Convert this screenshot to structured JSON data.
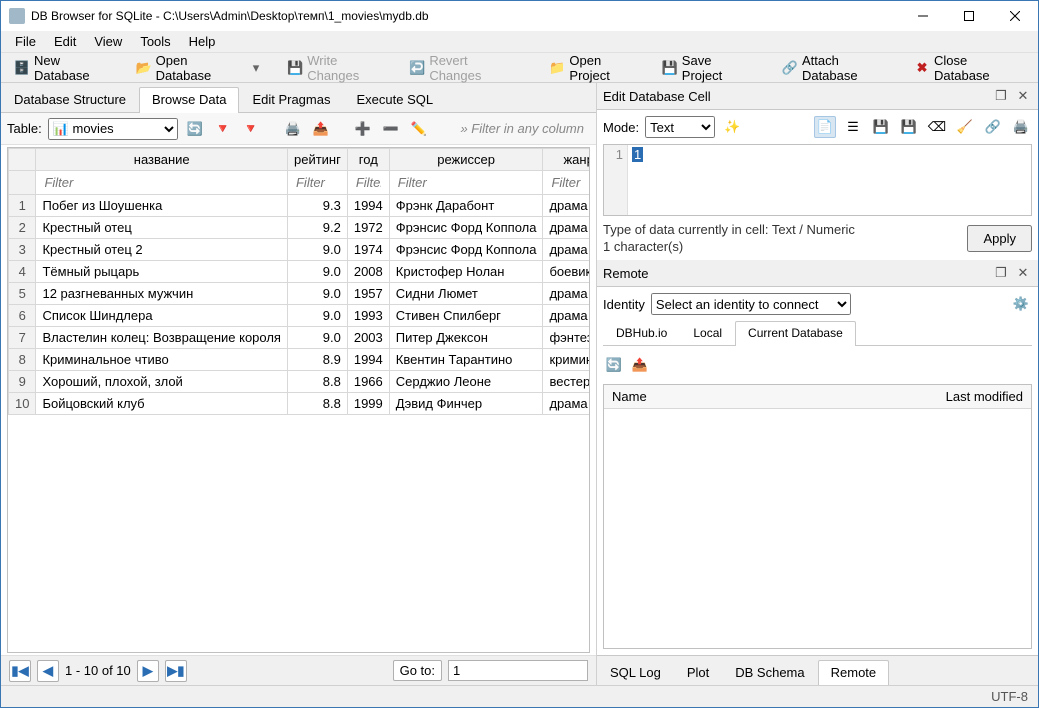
{
  "window_title": "DB Browser for SQLite - C:\\Users\\Admin\\Desktop\\темп\\1_movies\\mydb.db",
  "menus": [
    "File",
    "Edit",
    "View",
    "Tools",
    "Help"
  ],
  "toolbar": {
    "new_db": "New Database",
    "open_db": "Open Database",
    "write_changes": "Write Changes",
    "revert_changes": "Revert Changes",
    "open_project": "Open Project",
    "save_project": "Save Project",
    "attach_db": "Attach Database",
    "close_db": "Close Database"
  },
  "main_tabs": [
    "Database Structure",
    "Browse Data",
    "Edit Pragmas",
    "Execute SQL"
  ],
  "main_tab_active": 1,
  "browse": {
    "table_label": "Table:",
    "table_select_icon": "table-icon",
    "table_name": "movies",
    "filter_any": "Filter in any column"
  },
  "grid": {
    "columns": [
      "название",
      "рейтинг",
      "год",
      "режиссер",
      "жанр"
    ],
    "filter_placeholder": "Filter",
    "rows": [
      {
        "n": 1,
        "name": "Побег из Шоушенка",
        "rating": "9.3",
        "year": "1994",
        "dir": "Фрэнк Дарабонт",
        "genre": "драма"
      },
      {
        "n": 2,
        "name": "Крестный отец",
        "rating": "9.2",
        "year": "1972",
        "dir": "Фрэнсис Форд Коппола",
        "genre": "драма"
      },
      {
        "n": 3,
        "name": "Крестный отец 2",
        "rating": "9.0",
        "year": "1974",
        "dir": "Фрэнсис Форд Коппола",
        "genre": "драма"
      },
      {
        "n": 4,
        "name": "Тёмный рыцарь",
        "rating": "9.0",
        "year": "2008",
        "dir": "Кристофер Нолан",
        "genre": "боевик"
      },
      {
        "n": 5,
        "name": "12 разгневанных мужчин",
        "rating": "9.0",
        "year": "1957",
        "dir": "Сидни Люмет",
        "genre": "драма"
      },
      {
        "n": 6,
        "name": "Список Шиндлера",
        "rating": "9.0",
        "year": "1993",
        "dir": "Стивен Спилберг",
        "genre": "драма"
      },
      {
        "n": 7,
        "name": "Властелин колец: Возвращение короля",
        "rating": "9.0",
        "year": "2003",
        "dir": "Питер Джексон",
        "genre": "фэнтези"
      },
      {
        "n": 8,
        "name": "Криминальное чтиво",
        "rating": "8.9",
        "year": "1994",
        "dir": "Квентин Тарантино",
        "genre": "криминал"
      },
      {
        "n": 9,
        "name": "Хороший, плохой, злой",
        "rating": "8.8",
        "year": "1966",
        "dir": "Серджио Леоне",
        "genre": "вестерн"
      },
      {
        "n": 10,
        "name": "Бойцовский клуб",
        "rating": "8.8",
        "year": "1999",
        "dir": "Дэвид Финчер",
        "genre": "драма"
      }
    ]
  },
  "pager": {
    "range": "1 - 10 of 10",
    "goto_label": "Go to:",
    "goto_value": "1"
  },
  "editcell": {
    "title": "Edit Database Cell",
    "mode_label": "Mode:",
    "mode_value": "Text",
    "line_no": "1",
    "content": "1",
    "type_line": "Type of data currently in cell: Text / Numeric",
    "char_line": "1 character(s)",
    "apply": "Apply"
  },
  "remote": {
    "title": "Remote",
    "identity_label": "Identity",
    "identity_value": "Select an identity to connect",
    "tabs": [
      "DBHub.io",
      "Local",
      "Current Database"
    ],
    "tab_active": 2,
    "col_name": "Name",
    "col_modified": "Last modified"
  },
  "bottom_tabs": [
    "SQL Log",
    "Plot",
    "DB Schema",
    "Remote"
  ],
  "bottom_tab_active": 3,
  "status": {
    "encoding": "UTF-8"
  },
  "icons": {
    "db": "database-icon",
    "folder": "folder-icon",
    "save": "save-icon",
    "revert": "revert-icon",
    "open_proj": "open-project-icon",
    "save_proj": "save-project-icon",
    "attach": "attach-icon",
    "close": "close-icon",
    "refresh": "refresh-icon",
    "funnel": "funnel-icon",
    "clear": "clear-filter-icon",
    "copy": "copy-icon",
    "print": "print-icon",
    "add_row": "add-row-icon",
    "del_row": "delete-row-icon",
    "edit": "edit-icon",
    "text": "text-mode-icon",
    "hex": "hex-mode-icon",
    "disk": "disk-icon"
  }
}
